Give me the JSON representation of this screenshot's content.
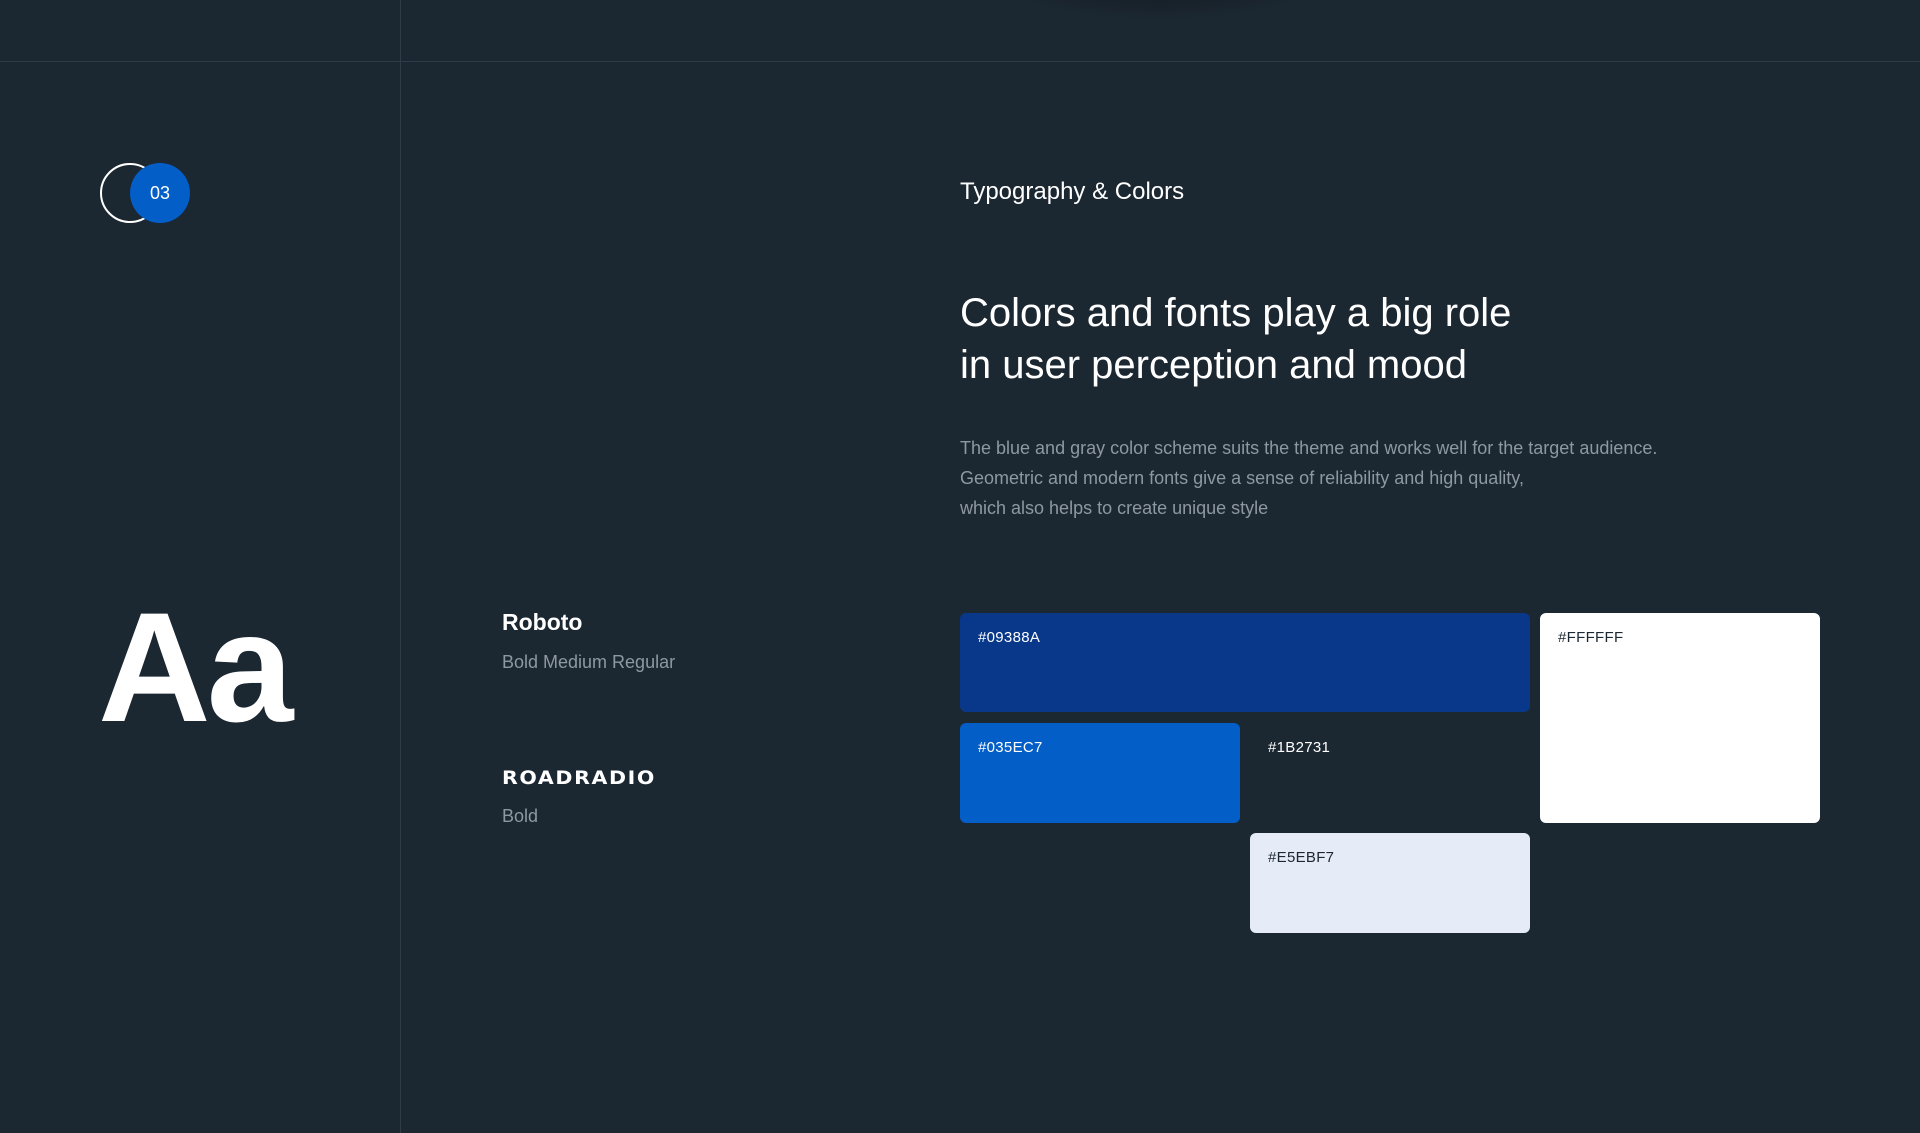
{
  "section": {
    "number": "03"
  },
  "typography": {
    "sample": "Aa",
    "fonts": [
      {
        "name": "Roboto",
        "weights": "Bold Medium Regular"
      },
      {
        "name": "ROADRADIO",
        "weights": "Bold"
      }
    ]
  },
  "content": {
    "eyebrow": "Typography & Colors",
    "headline_lines": [
      "Colors and fonts play a big role",
      "in user perception and mood"
    ],
    "description_lines": [
      "The blue and gray color scheme suits the theme and works well for the target audience.",
      "Geometric and modern fonts give a sense of reliability and high quality,",
      "which also helps to create unique style"
    ]
  },
  "palette": [
    {
      "hex": "#09388A"
    },
    {
      "hex": "#FFFFFF"
    },
    {
      "hex": "#035EC7"
    },
    {
      "hex": "#1B2731"
    },
    {
      "hex": "#E5EBF7"
    }
  ]
}
